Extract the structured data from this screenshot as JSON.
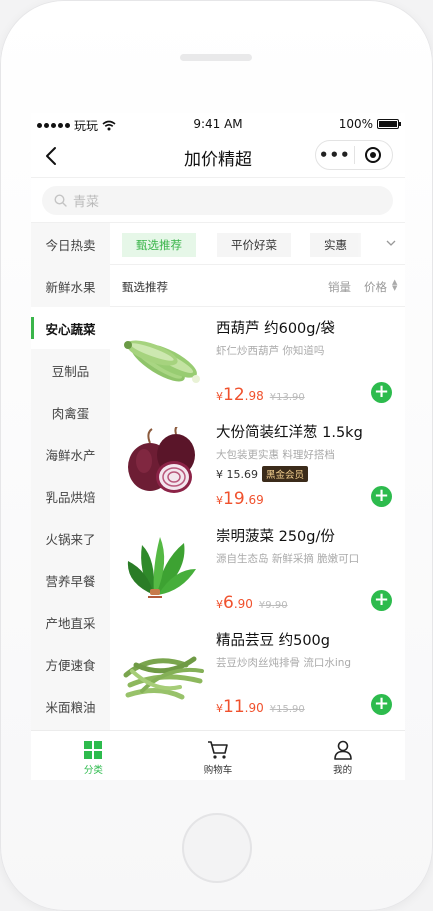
{
  "status": {
    "carrier": "玩玩",
    "time": "9:41 AM",
    "battery": "100%"
  },
  "nav": {
    "title": "加价精超",
    "more": "•••"
  },
  "search": {
    "placeholder": "青菜"
  },
  "sidebar": {
    "items": [
      {
        "label": "今日热卖"
      },
      {
        "label": "新鲜水果"
      },
      {
        "label": "安心蔬菜",
        "active": true
      },
      {
        "label": "豆制品"
      },
      {
        "label": "肉禽蛋"
      },
      {
        "label": "海鲜水产"
      },
      {
        "label": "乳品烘焙"
      },
      {
        "label": "火锅来了"
      },
      {
        "label": "营养早餐"
      },
      {
        "label": "产地直采"
      },
      {
        "label": "方便速食"
      },
      {
        "label": "米面粮油"
      }
    ]
  },
  "chips": [
    "甄选推荐",
    "平价好菜",
    "实惠"
  ],
  "sort": {
    "title": "甄选推荐",
    "sales": "销量",
    "price": "价格"
  },
  "products": [
    {
      "name": "西葫芦 约600g/袋",
      "desc": "虾仁炒西葫芦 你知道吗",
      "currency": "¥",
      "price_int": "12",
      "price_dec": ".98",
      "old": "¥13.90",
      "image": "zucchini"
    },
    {
      "name": "大份简装红洋葱 1.5kg",
      "desc": "大包装更实惠 料理好搭档",
      "member_price": "¥ 15.69",
      "member_badge": "黑金会员",
      "currency": "¥",
      "price_int": "19",
      "price_dec": ".69",
      "old": "",
      "image": "red-onion"
    },
    {
      "name": "崇明菠菜 250g/份",
      "desc": "源自生态岛 新鲜采摘 脆嫩可口",
      "currency": "¥",
      "price_int": "6",
      "price_dec": ".90",
      "old": "¥9.90",
      "image": "spinach"
    },
    {
      "name": "精品芸豆 约500g",
      "desc": "芸豆炒肉丝炖排骨 流口水ing",
      "currency": "¥",
      "price_int": "11",
      "price_dec": ".90",
      "old": "¥15.90",
      "image": "green-beans"
    }
  ],
  "tabbar": [
    {
      "label": "分类",
      "icon": "grid-icon",
      "active": true
    },
    {
      "label": "购物车",
      "icon": "cart-icon"
    },
    {
      "label": "我的",
      "icon": "user-icon"
    }
  ],
  "colors": {
    "accent": "#2dbb4d",
    "price": "#f0512d"
  }
}
